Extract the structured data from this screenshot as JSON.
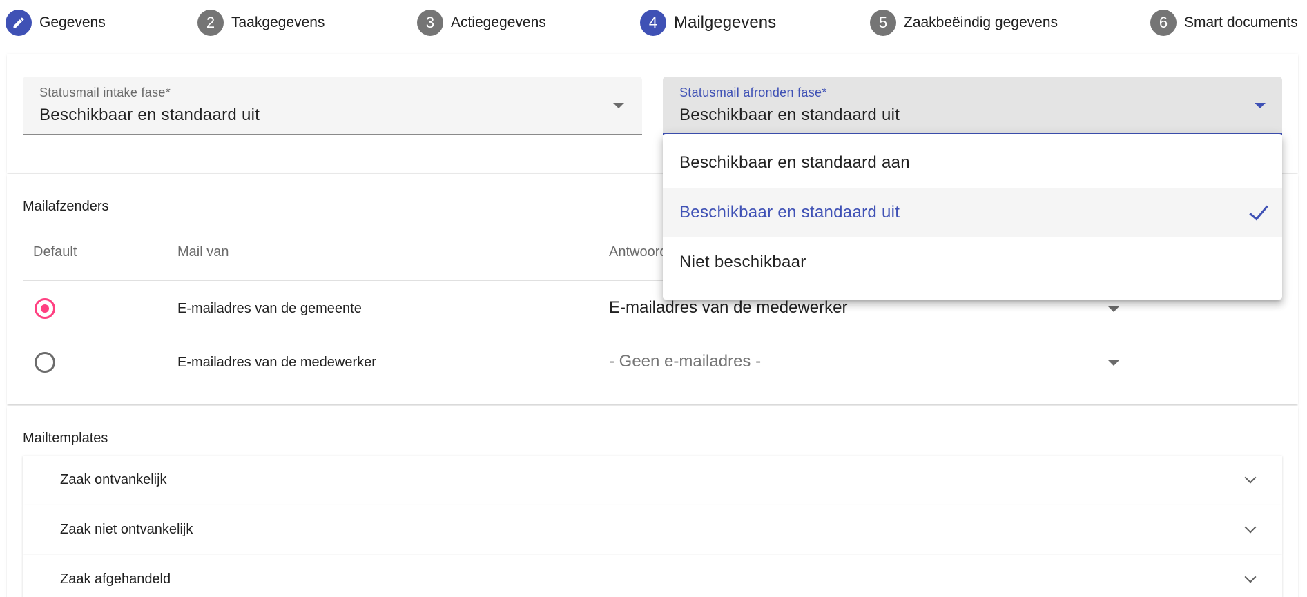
{
  "stepper": {
    "steps": [
      {
        "number": "",
        "label": "Gegevens",
        "state": "done",
        "icon": "edit-pencil-icon"
      },
      {
        "number": "2",
        "label": "Taakgegevens",
        "state": "default"
      },
      {
        "number": "3",
        "label": "Actiegegevens",
        "state": "default"
      },
      {
        "number": "4",
        "label": "Mailgegevens",
        "state": "current"
      },
      {
        "number": "5",
        "label": "Zaakbeëindig gegevens",
        "state": "default"
      },
      {
        "number": "6",
        "label": "Smart documents",
        "state": "default"
      }
    ]
  },
  "status_fields": {
    "intake": {
      "label": "Statusmail intake fase*",
      "value": "Beschikbaar en standaard uit"
    },
    "afronden": {
      "label": "Statusmail afronden fase*",
      "value": "Beschikbaar en standaard uit"
    }
  },
  "mailafzenders": {
    "title": "Mailafzenders",
    "columns": [
      "Default",
      "Mail van",
      "Antwoord"
    ],
    "rows": [
      {
        "default": true,
        "mail_van": "E-mailadres van de gemeente",
        "antwoord": "E-mailadres van de medewerker"
      },
      {
        "default": false,
        "mail_van": "E-mailadres van de medewerker",
        "antwoord": "- Geen e-mailadres -"
      }
    ]
  },
  "mailtemplates": {
    "title": "Mailtemplates",
    "items": [
      "Zaak ontvankelijk",
      "Zaak niet ontvankelijk",
      "Zaak afgehandeld"
    ]
  },
  "dropdown": {
    "options": [
      "Beschikbaar en standaard aan",
      "Beschikbaar en standaard uit",
      "Niet beschikbaar"
    ],
    "selected": "Beschikbaar en standaard uit"
  },
  "colors": {
    "primary": "#3f51b5",
    "accent": "#ff4081",
    "step_default": "#757575"
  }
}
